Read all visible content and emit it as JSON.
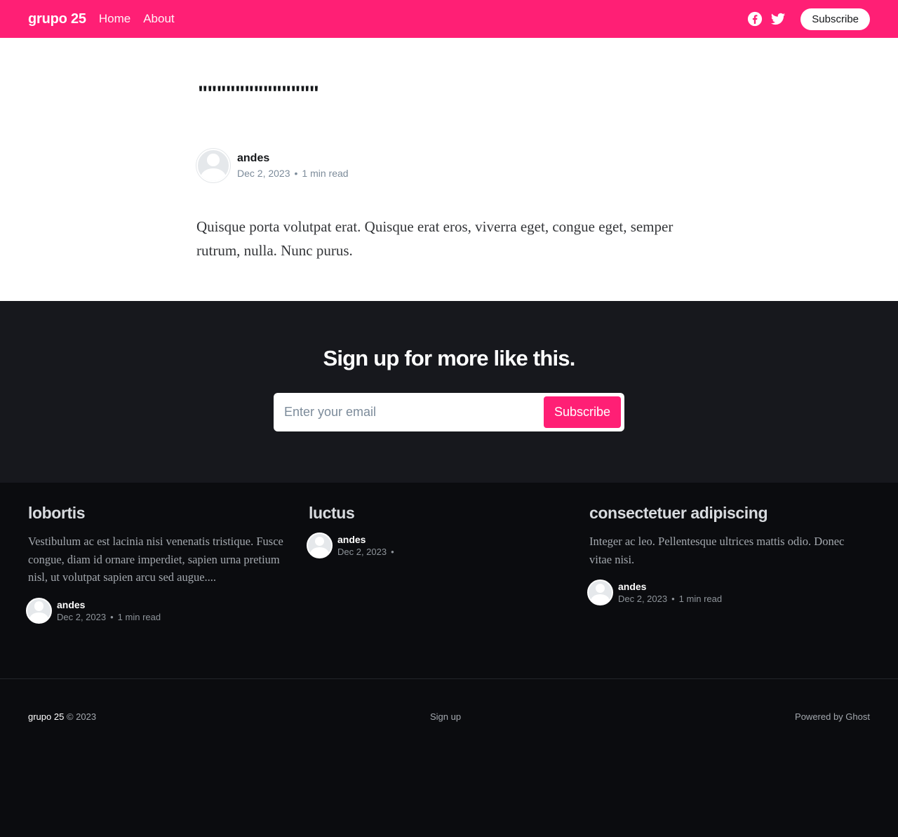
{
  "header": {
    "logo": "grupo 25",
    "nav": [
      {
        "label": "Home"
      },
      {
        "label": "About"
      }
    ],
    "subscribe_label": "Subscribe",
    "accent_color": "#ff1f75"
  },
  "article": {
    "title": "\"\"\"\"\"\"\"\"\"\"\"\"\"",
    "author": "andes",
    "date": "Dec 2, 2023",
    "read_time": "1 min read",
    "body": "Quisque porta volutpat erat. Quisque erat eros, viverra eget, congue eget, semper rutrum, nulla. Nunc purus."
  },
  "signup": {
    "title": "Sign up for more like this.",
    "email_placeholder": "Enter your email",
    "button_label": "Subscribe"
  },
  "related": [
    {
      "title": "lobortis",
      "excerpt": "Vestibulum ac est lacinia nisi venenatis tristique. Fusce congue, diam id ornare imperdiet, sapien urna pretium nisl, ut volutpat sapien arcu sed augue....",
      "author": "andes",
      "date": "Dec 2, 2023",
      "read_time": "1 min read"
    },
    {
      "title": "luctus",
      "excerpt": "",
      "author": "andes",
      "date": "Dec 2, 2023",
      "read_time": ""
    },
    {
      "title": "consectetuer adipiscing",
      "excerpt": "Integer ac leo. Pellentesque ultrices mattis odio. Donec vitae nisi.",
      "author": "andes",
      "date": "Dec 2, 2023",
      "read_time": "1 min read"
    }
  ],
  "footer": {
    "brand": "grupo 25",
    "copyright": " © 2023",
    "signup_link": "Sign up",
    "powered_by": "Powered by Ghost"
  }
}
